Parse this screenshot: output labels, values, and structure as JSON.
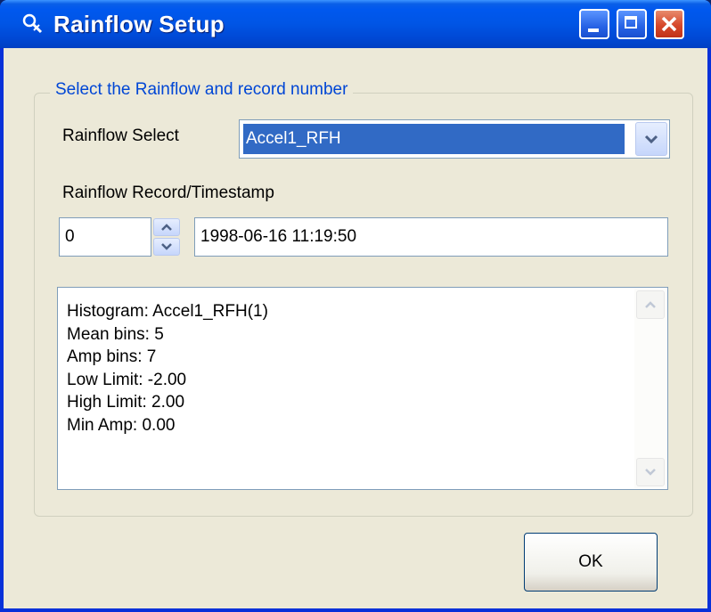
{
  "window": {
    "title": "Rainflow Setup"
  },
  "group": {
    "title": "Select the Rainflow and record number"
  },
  "rainflow_select": {
    "label": "Rainflow Select",
    "value": "Accel1_RFH"
  },
  "record": {
    "label": "Rainflow Record/Timestamp",
    "number": "0",
    "timestamp": "1998-06-16 11:19:50"
  },
  "info": {
    "lines": [
      "Histogram: Accel1_RFH(1)",
      "Mean bins: 5",
      "Amp bins: 7",
      "Low Limit: -2.00",
      "High Limit: 2.00",
      "Min Amp: 0.00"
    ]
  },
  "buttons": {
    "ok": "OK"
  },
  "icons": {
    "app": "rainflow-app-icon",
    "minimize": "minimize-icon",
    "maximize": "maximize-icon",
    "close": "close-icon",
    "dropdown": "chevron-down-icon",
    "spin_up": "spin-up-icon",
    "spin_down": "spin-down-icon"
  },
  "colors": {
    "titlebar": "#0055e5",
    "accent_title": "#0046d5",
    "selection": "#316ac5",
    "dialog_bg": "#ece9d8",
    "close_button": "#d6482b"
  }
}
